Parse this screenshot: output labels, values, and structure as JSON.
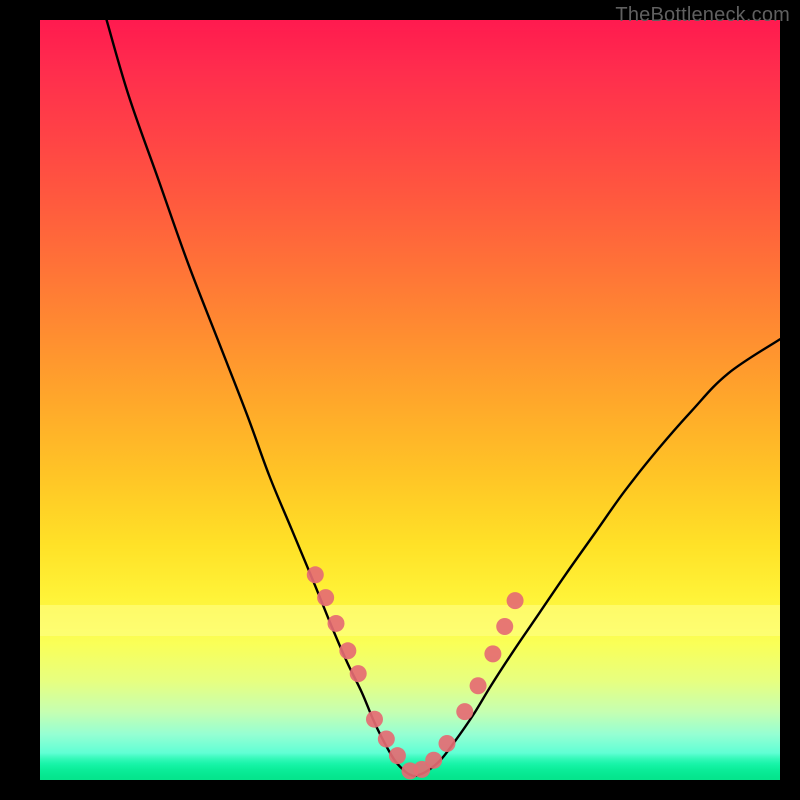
{
  "watermark": "TheBottleneck.com",
  "colors": {
    "background": "#000000",
    "gradient_top": "#ff1a4f",
    "gradient_mid": "#ffe127",
    "gradient_bottom": "#05e88f",
    "curve": "#000000",
    "marker": "#e56b73",
    "watermark": "#606060"
  },
  "chart_data": {
    "type": "line",
    "title": "",
    "xlabel": "",
    "ylabel": "",
    "xlim": [
      0,
      100
    ],
    "ylim": [
      0,
      100
    ],
    "grid": false,
    "legend": false,
    "description": "V-shaped bottleneck curve on a vertical rainbow gradient; minimum near x≈50 at y≈0. Left branch starts at top-left (x≈9, y≈100), right branch ends near (x≈100, y≈58). Pink markers cluster along both branches near the bottom (roughly y 5–30) and at the trough.",
    "series": [
      {
        "name": "left-branch",
        "x": [
          9,
          12,
          16,
          20,
          24,
          28,
          31,
          34,
          37,
          39.5,
          41.5,
          43.5,
          45,
          46.5,
          48,
          49.5,
          50.5
        ],
        "values": [
          100,
          90,
          79,
          68,
          58,
          48,
          40,
          33,
          26,
          20,
          15.5,
          11.5,
          8,
          5,
          2.5,
          1,
          0.5
        ]
      },
      {
        "name": "right-branch",
        "x": [
          50.5,
          52,
          54,
          56,
          58.5,
          61,
          64,
          67.5,
          71,
          75,
          79,
          83.5,
          88,
          93,
          100
        ],
        "values": [
          0.5,
          1,
          2.5,
          5,
          8.5,
          12.5,
          17,
          22,
          27,
          32.5,
          38,
          43.5,
          48.5,
          53.5,
          58
        ]
      }
    ],
    "markers": {
      "name": "highlight-points",
      "color": "#e56b73",
      "x": [
        37.2,
        38.6,
        40.0,
        41.6,
        43.0,
        45.2,
        46.8,
        48.3,
        50.0,
        51.6,
        53.2,
        55.0,
        57.4,
        59.2,
        61.2,
        62.8,
        64.2
      ],
      "values": [
        27.0,
        24.0,
        20.6,
        17.0,
        14.0,
        8.0,
        5.4,
        3.2,
        1.2,
        1.4,
        2.6,
        4.8,
        9.0,
        12.4,
        16.6,
        20.2,
        23.6
      ]
    }
  }
}
